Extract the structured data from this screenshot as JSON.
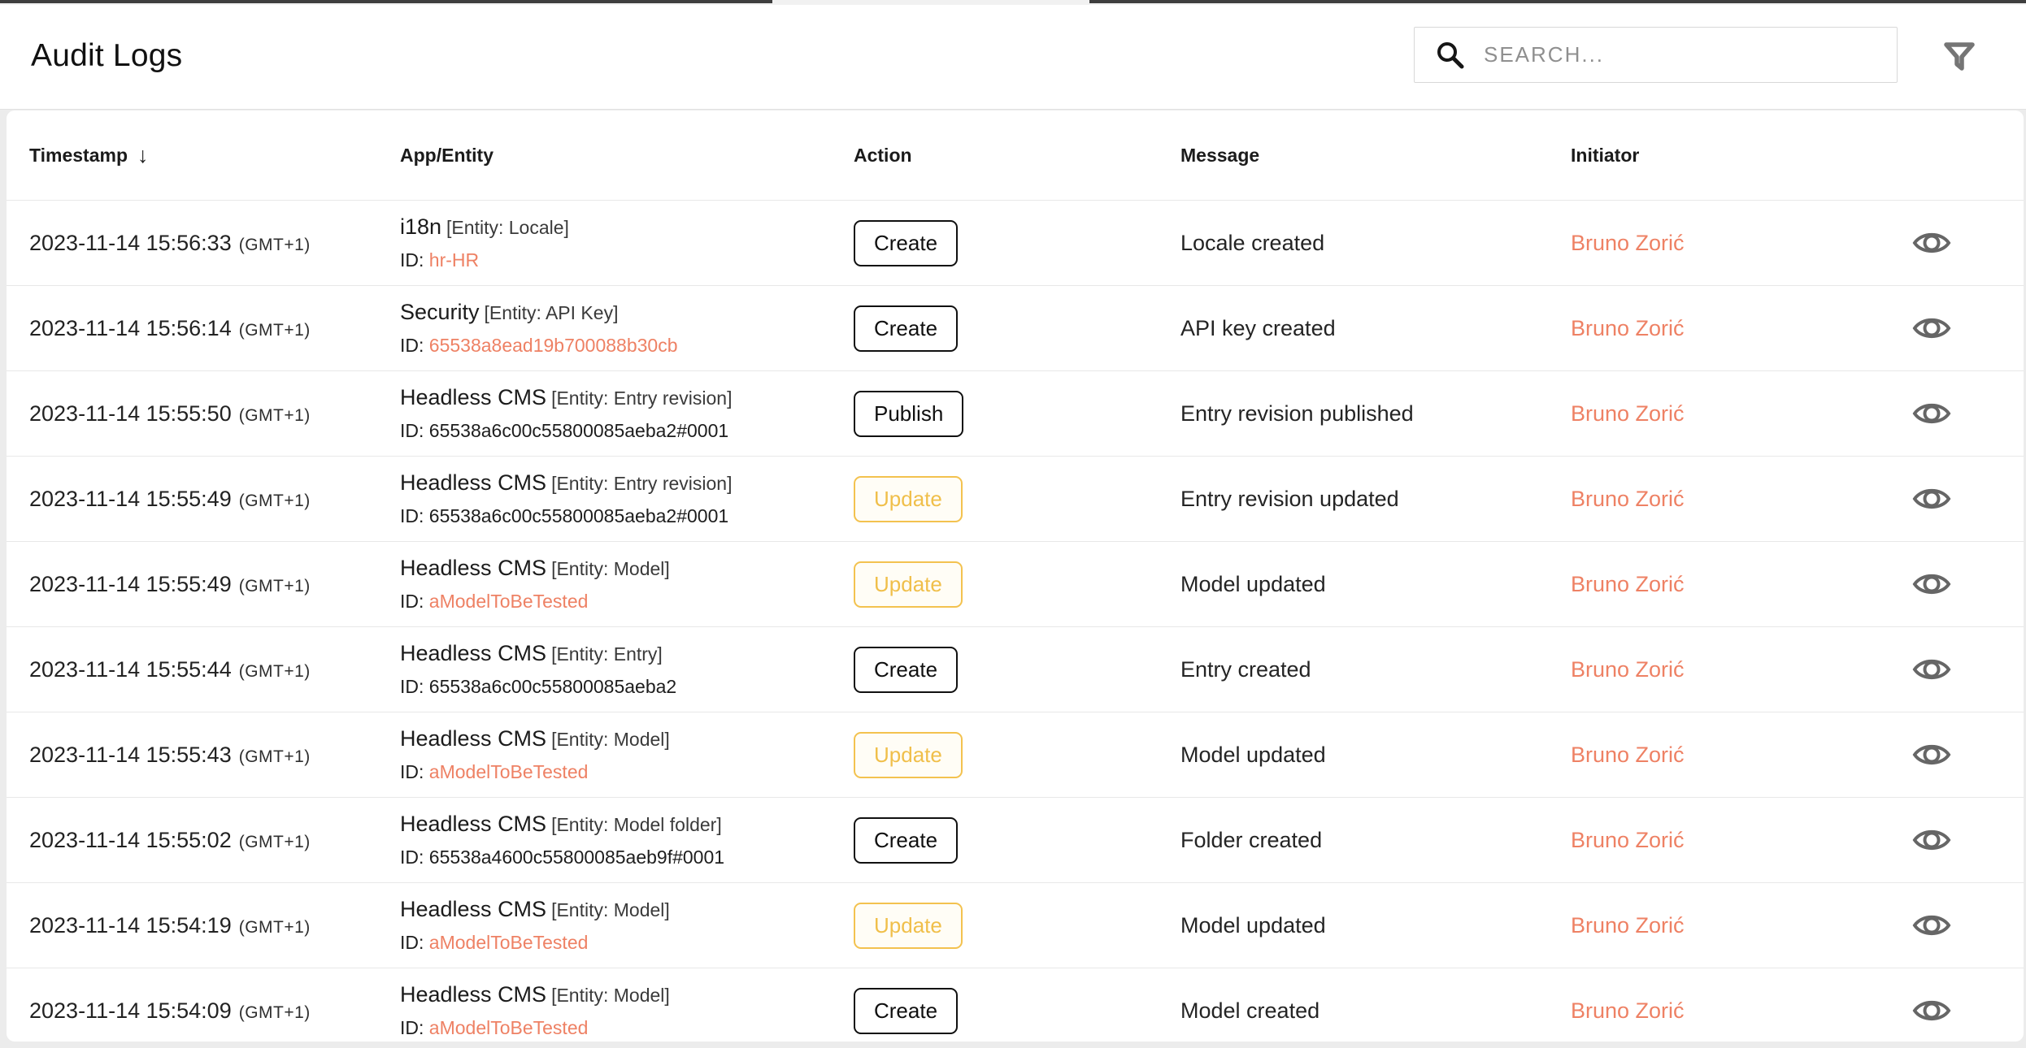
{
  "header": {
    "title": "Audit Logs",
    "search_placeholder": "SEARCH..."
  },
  "table": {
    "columns": [
      "Timestamp",
      "App/Entity",
      "Action",
      "Message",
      "Initiator"
    ],
    "sort_arrow": "↓",
    "id_prefix": "ID: ",
    "rows": [
      {
        "timestamp": "2023-11-14 15:56:33",
        "timezone": "(GMT+1)",
        "app": "i18n",
        "entity": "[Entity: Locale]",
        "id": "hr-HR",
        "id_is_link": true,
        "action": "Create",
        "action_variant": "default",
        "message": "Locale created",
        "initiator": "Bruno Zorić"
      },
      {
        "timestamp": "2023-11-14 15:56:14",
        "timezone": "(GMT+1)",
        "app": "Security",
        "entity": "[Entity: API Key]",
        "id": "65538a8ead19b700088b30cb",
        "id_is_link": true,
        "action": "Create",
        "action_variant": "default",
        "message": "API key created",
        "initiator": "Bruno Zorić"
      },
      {
        "timestamp": "2023-11-14 15:55:50",
        "timezone": "(GMT+1)",
        "app": "Headless CMS",
        "entity": "[Entity: Entry revision]",
        "id": "65538a6c00c55800085aeba2#0001",
        "id_is_link": false,
        "action": "Publish",
        "action_variant": "default",
        "message": "Entry revision published",
        "initiator": "Bruno Zorić"
      },
      {
        "timestamp": "2023-11-14 15:55:49",
        "timezone": "(GMT+1)",
        "app": "Headless CMS",
        "entity": "[Entity: Entry revision]",
        "id": "65538a6c00c55800085aeba2#0001",
        "id_is_link": false,
        "action": "Update",
        "action_variant": "warning",
        "message": "Entry revision updated",
        "initiator": "Bruno Zorić"
      },
      {
        "timestamp": "2023-11-14 15:55:49",
        "timezone": "(GMT+1)",
        "app": "Headless CMS",
        "entity": "[Entity: Model]",
        "id": "aModelToBeTested",
        "id_is_link": true,
        "action": "Update",
        "action_variant": "warning",
        "message": "Model updated",
        "initiator": "Bruno Zorić"
      },
      {
        "timestamp": "2023-11-14 15:55:44",
        "timezone": "(GMT+1)",
        "app": "Headless CMS",
        "entity": "[Entity: Entry]",
        "id": "65538a6c00c55800085aeba2",
        "id_is_link": false,
        "action": "Create",
        "action_variant": "default",
        "message": "Entry created",
        "initiator": "Bruno Zorić"
      },
      {
        "timestamp": "2023-11-14 15:55:43",
        "timezone": "(GMT+1)",
        "app": "Headless CMS",
        "entity": "[Entity: Model]",
        "id": "aModelToBeTested",
        "id_is_link": true,
        "action": "Update",
        "action_variant": "warning",
        "message": "Model updated",
        "initiator": "Bruno Zorić"
      },
      {
        "timestamp": "2023-11-14 15:55:02",
        "timezone": "(GMT+1)",
        "app": "Headless CMS",
        "entity": "[Entity: Model folder]",
        "id": "65538a4600c55800085aeb9f#0001",
        "id_is_link": false,
        "action": "Create",
        "action_variant": "default",
        "message": "Folder created",
        "initiator": "Bruno Zorić"
      },
      {
        "timestamp": "2023-11-14 15:54:19",
        "timezone": "(GMT+1)",
        "app": "Headless CMS",
        "entity": "[Entity: Model]",
        "id": "aModelToBeTested",
        "id_is_link": true,
        "action": "Update",
        "action_variant": "warning",
        "message": "Model updated",
        "initiator": "Bruno Zorić"
      },
      {
        "timestamp": "2023-11-14 15:54:09",
        "timezone": "(GMT+1)",
        "app": "Headless CMS",
        "entity": "[Entity: Model]",
        "id": "aModelToBeTested",
        "id_is_link": true,
        "action": "Create",
        "action_variant": "default",
        "message": "Model created",
        "initiator": "Bruno Zorić"
      }
    ]
  },
  "colors": {
    "accent_orange": "#ee8164",
    "warning_yellow": "#f2c04d",
    "text_dark": "#1d1d1d",
    "divider": "#e8e8e8",
    "page_background": "#ececec"
  }
}
